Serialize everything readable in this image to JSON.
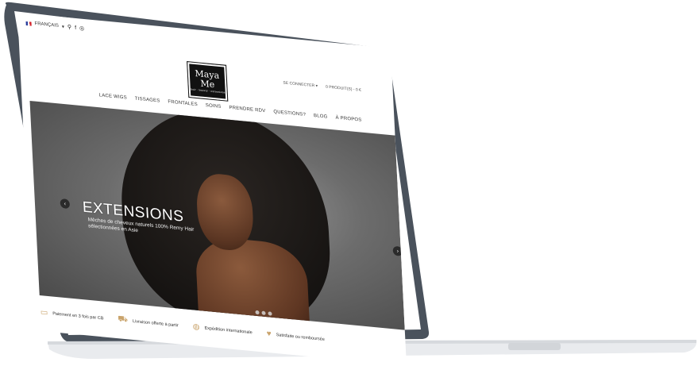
{
  "topbar": {
    "language": "FRANÇAIS",
    "language_caret": "▾",
    "search_icon": "search-icon",
    "facebook_icon": "facebook-icon",
    "instagram_icon": "instagram-icon"
  },
  "account": {
    "login": "SE CONNECTER ▾",
    "cart": "0 PRODUIT(S) - 0 €"
  },
  "logo": {
    "line1": "Maya",
    "line2": "Me",
    "tagline": "hair · beauty · extensions"
  },
  "nav": {
    "items": [
      {
        "label": "LACE WIGS"
      },
      {
        "label": "TISSAGES"
      },
      {
        "label": "FRONTALES"
      },
      {
        "label": "SOINS"
      },
      {
        "label": "PRENDRE RDV"
      },
      {
        "label": "QUESTIONS?"
      },
      {
        "label": "BLOG"
      },
      {
        "label": "À PROPOS"
      }
    ]
  },
  "hero": {
    "title": "EXTENSIONS",
    "subtitle": "Mèches de cheveux naturels 100% Remy Hair sélectionnées en Asie",
    "prev": "‹",
    "next": "›"
  },
  "features": [
    {
      "icon": "credit-card-icon",
      "glyph": "▭",
      "label": "Paiement en 3 fois par CB"
    },
    {
      "icon": "truck-icon",
      "glyph": "⛟",
      "label": "Livraison offerte à partir"
    },
    {
      "icon": "globe-icon",
      "glyph": "◍",
      "label": "Expédition internationale"
    },
    {
      "icon": "heart-icon",
      "glyph": "♥",
      "label": "Satisfaite ou remboursée"
    }
  ],
  "colors": {
    "bezel": "#4a525c",
    "base": "#e9ebee",
    "accent_gold": "#c9a36b"
  }
}
